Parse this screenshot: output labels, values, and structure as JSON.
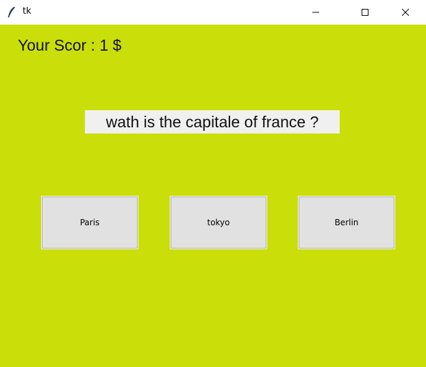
{
  "window": {
    "title": "tk"
  },
  "game": {
    "score_label": "Your Scor : 1 $",
    "question": "wath is the capitale of france ?",
    "answers": [
      "Paris",
      "tokyo",
      "Berlin"
    ]
  },
  "colors": {
    "background": "#cadf0a",
    "question_bg": "#f0f0f0",
    "button_bg": "#e1e1e1"
  }
}
